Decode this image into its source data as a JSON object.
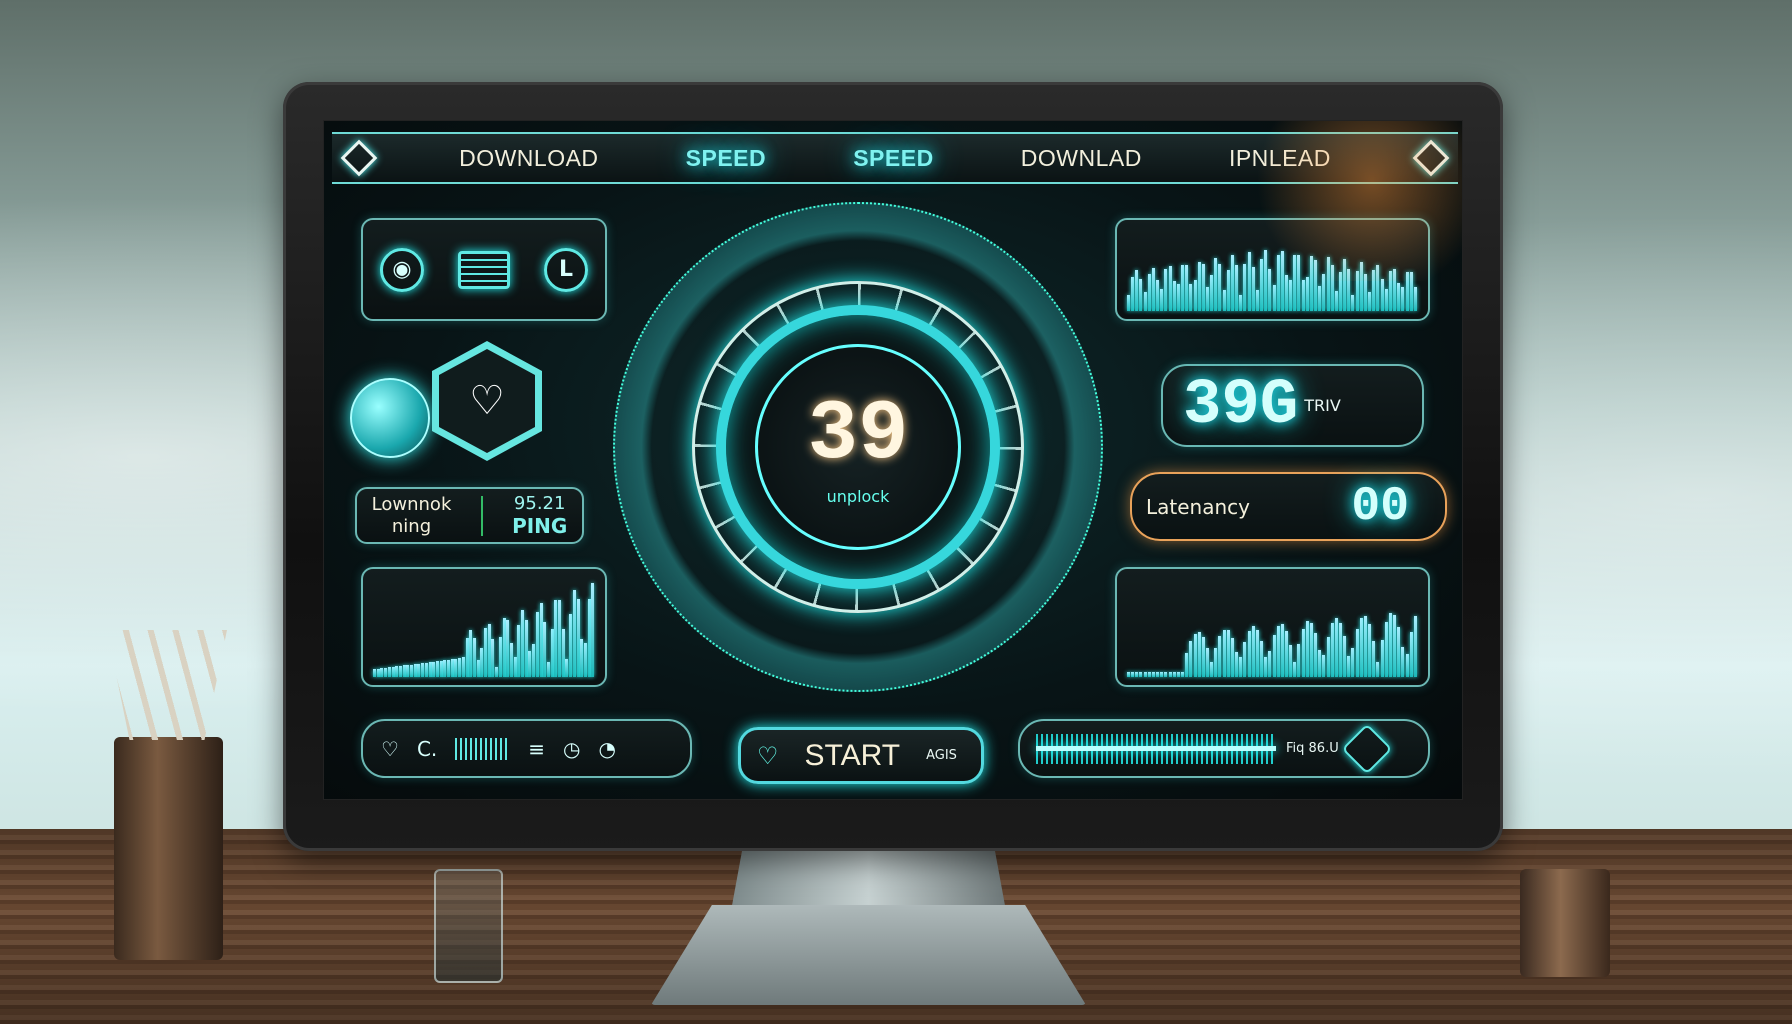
{
  "nav": {
    "items": [
      "DOWNLOAD",
      "SPEED",
      "SPEED",
      "DOWNLAD",
      "IPNLEAD"
    ],
    "active": [
      1,
      2
    ]
  },
  "left": {
    "top_icons": [
      "location-pin-icon",
      "message-icon",
      "clock-icon"
    ],
    "hex_icon": "heart-icon",
    "ping": {
      "label_line1": "Lownnok",
      "label_line2": "ning",
      "value": "95.21",
      "unit": "PING"
    }
  },
  "gauge": {
    "value": "39",
    "label": "unplock"
  },
  "right": {
    "speed_value": "39G",
    "speed_unit": "TRIV",
    "latency_label": "Latenancy",
    "latency_value": "00"
  },
  "bottom": {
    "start_label": "START",
    "start_sub": "AGIS",
    "progress_label": "Fiq 86.U"
  },
  "colors": {
    "accent": "#5fe9e4",
    "glow": "#22d8e0",
    "text": "#f2efdc"
  }
}
